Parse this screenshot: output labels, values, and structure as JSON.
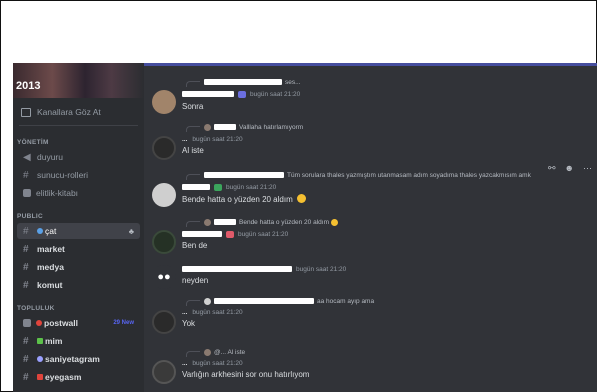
{
  "server": {
    "banner_text": "2013"
  },
  "sidebar": {
    "browse_label": "Kanallara Göz At",
    "categories": {
      "yonetim": "YÖNETİM",
      "public": "PUBLIC",
      "topluluk": "TOPLULUK"
    },
    "channels": [
      {
        "label": "duyuru",
        "icon": "megaphone-icon"
      },
      {
        "label": "sunucu-rolleri",
        "icon": "hash-icon"
      },
      {
        "label": "elitlik-kitabı",
        "icon": "book-icon"
      },
      {
        "label": "çat",
        "icon": "hash-icon",
        "active": true
      },
      {
        "label": "market",
        "icon": "hash-icon"
      },
      {
        "label": "medya",
        "icon": "hash-icon"
      },
      {
        "label": "komut",
        "icon": "hash-icon"
      },
      {
        "label": "postwall",
        "icon": "forum-icon",
        "badge": "29 New"
      },
      {
        "label": "mim",
        "icon": "hash-icon"
      },
      {
        "label": "saniyetagram",
        "icon": "hash-icon"
      },
      {
        "label": "eyegasm",
        "icon": "hash-icon"
      }
    ]
  },
  "messages": [
    {
      "reply_text": "ses...",
      "time": "bugün saat 21:20",
      "text": "Sonra"
    },
    {
      "reply_text": "Valllaha hatırlamıyorm",
      "prefix": "...",
      "time": "bugün saat 21:20",
      "text": "Al iste"
    },
    {
      "reply_text": "Tüm sorulara thales yazmıştım utanmasam adım soyadıma thales yazcakmısım amk",
      "time": "bugün saat 21:20",
      "text": "Bende hatta o yüzden 20 aldım"
    },
    {
      "reply_text": "Bende hatta o yüzden 20 aldım",
      "time": "bugün saat 21:20",
      "text": "Ben de"
    },
    {
      "time": "bugün saat 21:20",
      "text": "neyden"
    },
    {
      "reply_text": "aa hocam ayıp ama",
      "prefix": "...",
      "time": "bugün saat 21:20",
      "text": "Yok"
    },
    {
      "reply_text": "@... Al iste",
      "prefix": "...",
      "time": "bugün saat 21:20",
      "text": "Varlığın arkhesini sor onu hatırlıyom"
    }
  ],
  "colors": {
    "accent": "#5865f2",
    "sidebar_bg": "#2b2d31",
    "chat_bg": "#313338",
    "active_channel": "#404249"
  }
}
